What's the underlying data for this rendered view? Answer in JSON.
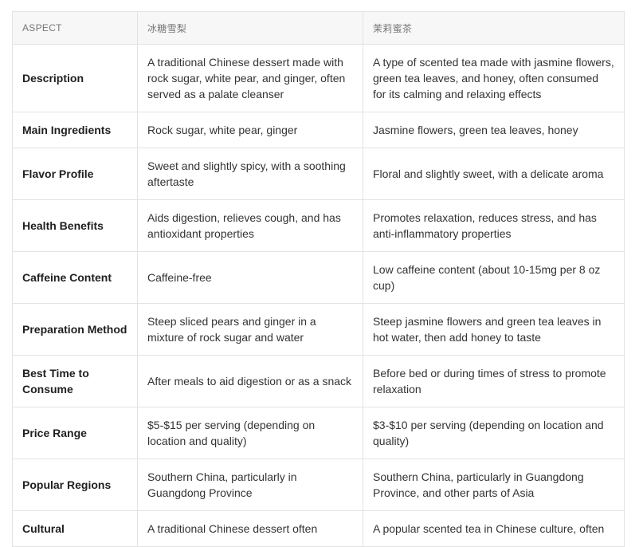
{
  "table": {
    "headers": [
      "ASPECT",
      "冰糖雪梨",
      "茉莉蜜茶"
    ],
    "rows": [
      {
        "aspect": "Description",
        "a": "A traditional Chinese dessert made with rock sugar, white pear, and ginger, often served as a palate cleanser",
        "b": "A type of scented tea made with jasmine flowers, green tea leaves, and honey, often consumed for its calming and relaxing effects"
      },
      {
        "aspect": "Main Ingredients",
        "a": "Rock sugar, white pear, ginger",
        "b": "Jasmine flowers, green tea leaves, honey"
      },
      {
        "aspect": "Flavor Profile",
        "a": "Sweet and slightly spicy, with a soothing aftertaste",
        "b": "Floral and slightly sweet, with a delicate aroma"
      },
      {
        "aspect": "Health Benefits",
        "a": "Aids digestion, relieves cough, and has antioxidant properties",
        "b": "Promotes relaxation, reduces stress, and has anti-inflammatory properties"
      },
      {
        "aspect": "Caffeine Content",
        "a": "Caffeine-free",
        "b": "Low caffeine content (about 10-15mg per 8 oz cup)"
      },
      {
        "aspect": "Preparation Method",
        "a": "Steep sliced pears and ginger in a mixture of rock sugar and water",
        "b": "Steep jasmine flowers and green tea leaves in hot water, then add honey to taste"
      },
      {
        "aspect": "Best Time to Consume",
        "a": "After meals to aid digestion or as a snack",
        "b": "Before bed or during times of stress to promote relaxation"
      },
      {
        "aspect": "Price Range",
        "a": "$5-$15 per serving (depending on location and quality)",
        "b": "$3-$10 per serving (depending on location and quality)"
      },
      {
        "aspect": "Popular Regions",
        "a": "Southern China, particularly in Guangdong Province",
        "b": "Southern China, particularly in Guangdong Province, and other parts of Asia"
      },
      {
        "aspect": "Cultural",
        "a": "A traditional Chinese dessert often",
        "b": "A popular scented tea in Chinese culture, often"
      }
    ]
  }
}
